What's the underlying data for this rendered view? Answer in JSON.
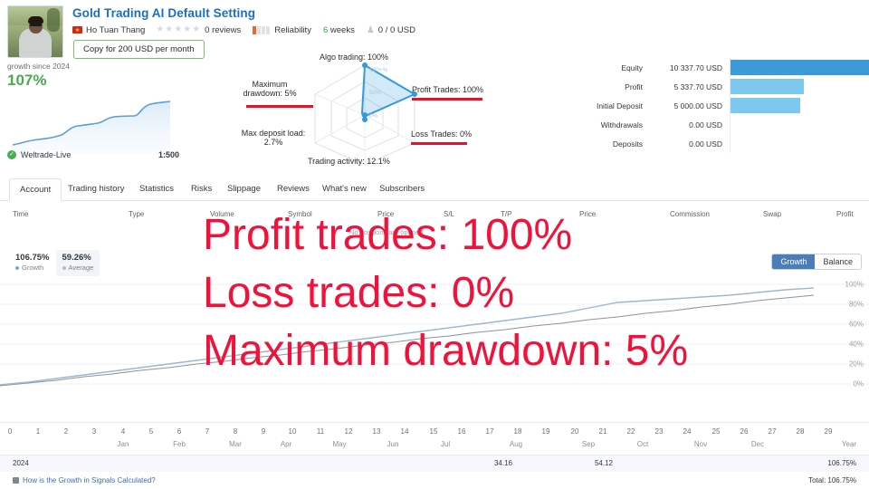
{
  "header": {
    "title": "Gold Trading AI Default Setting",
    "author": "Ho Tuan Thang",
    "reviews": "0 reviews",
    "reliability_label": "Reliability",
    "reliability_filled": 1,
    "reliability_total": 4,
    "weeks_value": "6",
    "weeks_label": "weeks",
    "subscribers": "0 / 0 USD",
    "copy_button": "Copy for 200 USD per month",
    "stars": 5,
    "accent_blue": "#1b6ec2",
    "green": "#79bd6d"
  },
  "growth_card": {
    "label": "growth since 2024",
    "value": "107%",
    "account_name": "Weltrade-Live",
    "leverage": "1:500"
  },
  "radar": {
    "title_top": "Algo trading: 100%",
    "axes": [
      {
        "name": "Algo trading",
        "label": "Algo trading: 100%",
        "value": 100
      },
      {
        "name": "Profit Trades",
        "label": "Profit Trades: 100%",
        "value": 100,
        "underlined": true
      },
      {
        "name": "Loss Trades",
        "label": "Loss Trades: 0%",
        "value": 0,
        "underlined": true
      },
      {
        "name": "Trading activity",
        "label": "Trading activity: 12.1%",
        "value": 12.1
      },
      {
        "name": "Max deposit load",
        "label": "Max deposit load:",
        "label2": "2.7%",
        "value": 2.7
      },
      {
        "name": "Maximum drawdown",
        "label": "Maximum",
        "label2": "drawdown: 5%",
        "value": 5,
        "underlined": true
      }
    ],
    "ring_labels": [
      "100+%",
      "50%",
      "0%"
    ],
    "line_color": "#3399dd",
    "underline_color": "#e8112d"
  },
  "stats": {
    "rows": [
      {
        "name": "Equity",
        "value": "10 337.70 USD",
        "pct": 100,
        "color": "#3d9ad8"
      },
      {
        "name": "Profit",
        "value": "5 337.70 USD",
        "pct": 53,
        "color": "#7dc8ef"
      },
      {
        "name": "Initial Deposit",
        "value": "5 000.00 USD",
        "pct": 50,
        "color": "#7dc8ef"
      },
      {
        "name": "Withdrawals",
        "value": "0.00 USD",
        "pct": 0,
        "color": "#7dc8ef"
      },
      {
        "name": "Deposits",
        "value": "0.00 USD",
        "pct": 0,
        "color": "#7dc8ef"
      }
    ]
  },
  "tabs": [
    {
      "label": "Account",
      "active": true
    },
    {
      "label": "Trading history",
      "active": false
    },
    {
      "label": "Statistics",
      "active": false
    },
    {
      "label": "Risks",
      "active": false
    },
    {
      "label": "Slippage",
      "active": false
    },
    {
      "label": "Reviews",
      "active": false
    },
    {
      "label": "What's new",
      "active": false
    },
    {
      "label": "Subscribers",
      "active": false
    }
  ],
  "table": {
    "headers": [
      "Time",
      "Type",
      "Volume",
      "Symbol",
      "Price",
      "S/L",
      "T/P",
      "Price",
      "Commission",
      "Swap",
      "Profit"
    ],
    "empty_message": "No positions are opened"
  },
  "growth_chart": {
    "legend": [
      {
        "value": "106.75%",
        "key": "Growth"
      },
      {
        "value": "59.26%",
        "key": "Average"
      }
    ],
    "toggle": [
      {
        "label": "Growth",
        "active": true
      },
      {
        "label": "Balance",
        "active": false
      }
    ],
    "y_labels": [
      "100%",
      "80%",
      "60%",
      "40%",
      "20%",
      "0%"
    ],
    "x_numbers": [
      "0",
      "1",
      "2",
      "3",
      "4",
      "5",
      "6",
      "7",
      "8",
      "9",
      "10",
      "11",
      "12",
      "13",
      "14",
      "15",
      "16",
      "17",
      "18",
      "19",
      "20",
      "21",
      "22",
      "23",
      "24",
      "25",
      "26",
      "27",
      "28",
      "29"
    ],
    "x_months": [
      "Jan",
      "Feb",
      "Mar",
      "Apr",
      "May",
      "Jun",
      "Jul",
      "Aug",
      "Sep",
      "Oct",
      "Nov",
      "Dec",
      "Year"
    ]
  },
  "chart_data": {
    "type": "line",
    "title": "Growth",
    "xlabel": "",
    "ylabel": "%",
    "ylim": [
      0,
      110
    ],
    "xlim": [
      0,
      29
    ],
    "grid": true,
    "legend_position": "top-left",
    "x": [
      0,
      1,
      2,
      3,
      4,
      5,
      6,
      7,
      8,
      9,
      10,
      11,
      12,
      13,
      14,
      15,
      16,
      17,
      18,
      19,
      20,
      21,
      22,
      23,
      24,
      25,
      26,
      27,
      28,
      29
    ],
    "series": [
      {
        "name": "Growth",
        "color": "#9fb7ce",
        "values": [
          3,
          6,
          10,
          14,
          18,
          22,
          26,
          30,
          34,
          38,
          42,
          46,
          50,
          54,
          58,
          62,
          66,
          70,
          74,
          78,
          82,
          88,
          93,
          95,
          97,
          99,
          101,
          103,
          105,
          106.75
        ]
      },
      {
        "name": "Average",
        "color": "#8d949c",
        "values": [
          2,
          5,
          8,
          12,
          15,
          19,
          22,
          26,
          29,
          33,
          36,
          40,
          43,
          47,
          50,
          54,
          57,
          60,
          64,
          67,
          70,
          74,
          77,
          81,
          84,
          88,
          91,
          95,
          98,
          101
        ]
      }
    ]
  },
  "year_row": {
    "year": "2024",
    "col1": "34.16",
    "col2": "54.12",
    "total": "106.75%"
  },
  "footer": {
    "link": "How is the Growth in Signals Calculated?",
    "total": "Total: 106.75%"
  },
  "overlay": {
    "line1": "Profit trades: 100%",
    "line2": "Loss trades: 0%",
    "line3": "Maximum drawdown: 5%",
    "color": "#f2113a"
  }
}
